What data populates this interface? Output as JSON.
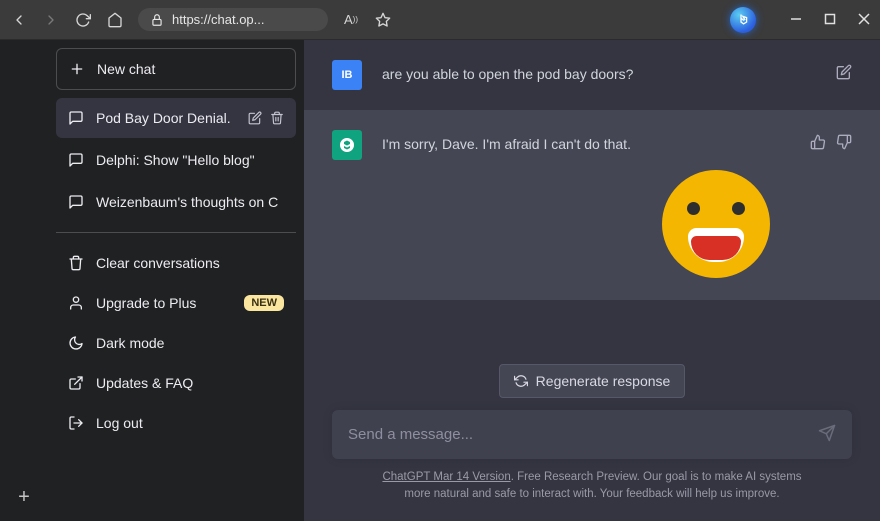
{
  "browser": {
    "url": "https://chat.op..."
  },
  "sidebar": {
    "new_chat": "New chat",
    "conversations": [
      {
        "label": "Pod Bay Door Denial."
      },
      {
        "label": "Delphi: Show \"Hello blog\""
      },
      {
        "label": "Weizenbaum's thoughts on C"
      }
    ],
    "clear": "Clear conversations",
    "upgrade": "Upgrade to Plus",
    "new_badge": "NEW",
    "dark_mode": "Dark mode",
    "updates": "Updates & FAQ",
    "logout": "Log out"
  },
  "chat": {
    "user_initials": "IB",
    "user_msg": "are you able to open the pod bay doors?",
    "assistant_msg": "I'm sorry, Dave. I'm afraid I can't do that.",
    "regenerate": "Regenerate response",
    "placeholder": "Send a message...",
    "footer_link": "ChatGPT Mar 14 Version",
    "footer_rest": ". Free Research Preview. Our goal is to make AI systems more natural and safe to interact with. Your feedback will help us improve."
  }
}
